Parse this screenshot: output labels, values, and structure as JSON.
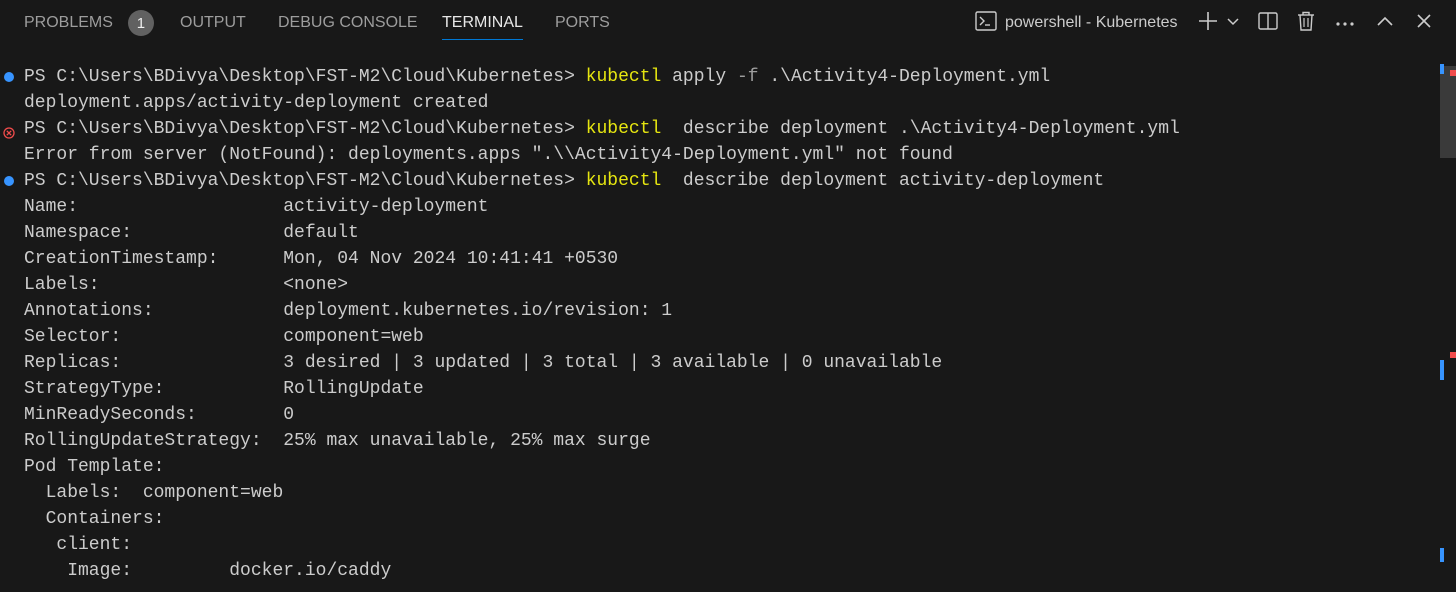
{
  "panel": {
    "tabs": {
      "problems": "PROBLEMS",
      "problems_count": "1",
      "output": "OUTPUT",
      "debug_console": "DEBUG CONSOLE",
      "terminal": "TERMINAL",
      "ports": "PORTS"
    },
    "active_tab": "TERMINAL",
    "terminal_name": "powershell - Kubernetes",
    "toolbar_icons": [
      "terminal-icon",
      "plus-icon",
      "chevron-down-icon",
      "split-icon",
      "trash-icon",
      "more-icon",
      "chevron-up-icon",
      "close-icon"
    ]
  },
  "terminal": {
    "prompt": "PS C:\\Users\\BDivya\\Desktop\\FST-M2\\Cloud\\Kubernetes> ",
    "cmd1": {
      "kw": "kubectl",
      "args_plain": " apply ",
      "flag": "-f",
      "args_rest": " .\\Activity4-Deployment.yml",
      "status": "success"
    },
    "out1": "deployment.apps/activity-deployment created",
    "cmd2": {
      "kw": "kubectl",
      "args": "  describe deployment .\\Activity4-Deployment.yml",
      "status": "error"
    },
    "out2": "Error from server (NotFound): deployments.apps \".\\\\Activity4-Deployment.yml\" not found",
    "cmd3": {
      "kw": "kubectl",
      "args": "  describe deployment activity-deployment",
      "status": "success"
    },
    "details": [
      "Name:                   activity-deployment",
      "Namespace:              default",
      "CreationTimestamp:      Mon, 04 Nov 2024 10:41:41 +0530",
      "Labels:                 <none>",
      "Annotations:            deployment.kubernetes.io/revision: 1",
      "Selector:               component=web",
      "Replicas:               3 desired | 3 updated | 3 total | 3 available | 0 unavailable",
      "StrategyType:           RollingUpdate",
      "MinReadySeconds:        0",
      "RollingUpdateStrategy:  25% max unavailable, 25% max surge",
      "Pod Template:",
      "  Labels:  component=web",
      "  Containers:",
      "   client:",
      "    Image:         docker.io/caddy"
    ]
  },
  "colors": {
    "background": "#181818",
    "text": "#cccccc",
    "command_keyword": "#e5e510",
    "success_dot": "#3794ff",
    "error_dot": "#f14c4c",
    "active_tab_underline": "#0078d4"
  }
}
